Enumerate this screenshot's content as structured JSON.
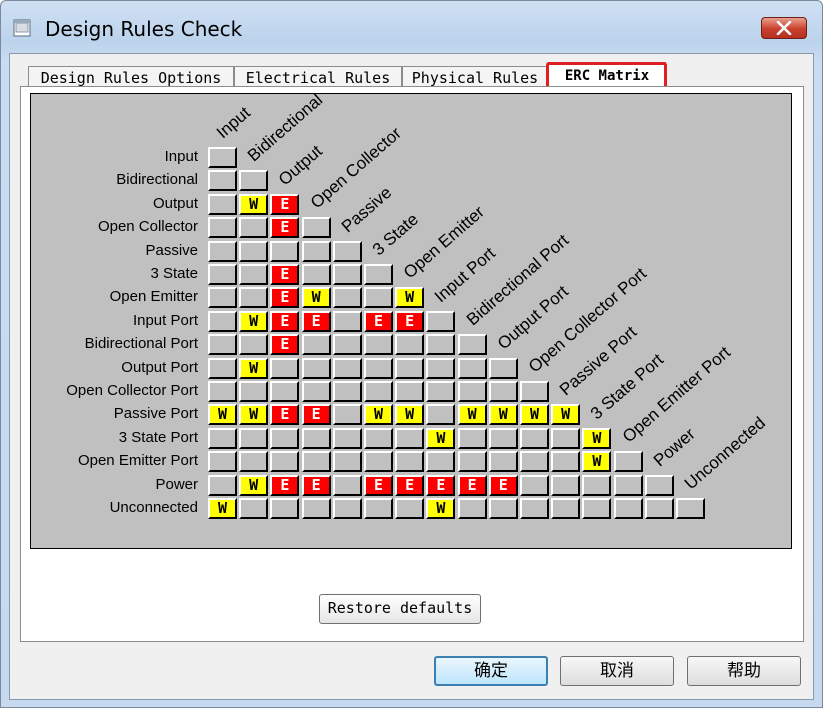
{
  "window": {
    "title": "Design Rules Check"
  },
  "tabs": [
    {
      "label": "Design Rules Options",
      "active": false
    },
    {
      "label": "Electrical Rules",
      "active": false
    },
    {
      "label": "Physical Rules",
      "active": false
    },
    {
      "label": "ERC Matrix",
      "active": true
    }
  ],
  "matrix": {
    "labels": [
      "Input",
      "Bidirectional",
      "Output",
      "Open Collector",
      "Passive",
      "3 State",
      "Open Emitter",
      "Input Port",
      "Bidirectional Port",
      "Output Port",
      "Open Collector Port",
      "Passive Port",
      "3 State Port",
      "Open Emitter Port",
      "Power",
      "Unconnected"
    ],
    "rows": [
      [
        ""
      ],
      [
        "",
        ""
      ],
      [
        "",
        "W",
        "E"
      ],
      [
        "",
        "",
        "E",
        ""
      ],
      [
        "",
        "",
        "",
        "",
        ""
      ],
      [
        "",
        "",
        "E",
        "",
        "",
        ""
      ],
      [
        "",
        "",
        "E",
        "W",
        "",
        "",
        "W"
      ],
      [
        "",
        "W",
        "E",
        "E",
        "",
        "E",
        "E",
        ""
      ],
      [
        "",
        "",
        "E",
        "",
        "",
        "",
        "",
        "",
        ""
      ],
      [
        "",
        "W",
        "",
        "",
        "",
        "",
        "",
        "",
        "",
        ""
      ],
      [
        "",
        "",
        "",
        "",
        "",
        "",
        "",
        "",
        "",
        "",
        ""
      ],
      [
        "W",
        "W",
        "E",
        "E",
        "",
        "W",
        "W",
        "",
        "W",
        "W",
        "W",
        "W"
      ],
      [
        "",
        "",
        "",
        "",
        "",
        "",
        "",
        "W",
        "",
        "",
        "",
        "",
        "W"
      ],
      [
        "",
        "",
        "",
        "",
        "",
        "",
        "",
        "",
        "",
        "",
        "",
        "",
        "W",
        ""
      ],
      [
        "",
        "W",
        "E",
        "E",
        "",
        "E",
        "E",
        "E",
        "E",
        "E",
        "",
        "",
        "",
        "",
        ""
      ],
      [
        "W",
        "",
        "",
        "",
        "",
        "",
        "",
        "W",
        "",
        "",
        "",
        "",
        "",
        "",
        "",
        ""
      ]
    ],
    "colors": {
      "warning": "#ffff00",
      "error": "#ff0000",
      "background": "#c0c0c0"
    }
  },
  "buttons": {
    "restore": "Restore defaults",
    "ok": "确定",
    "cancel": "取消",
    "help": "帮助"
  },
  "icons": {
    "app": "dialog-app-icon",
    "close": "close-icon"
  }
}
